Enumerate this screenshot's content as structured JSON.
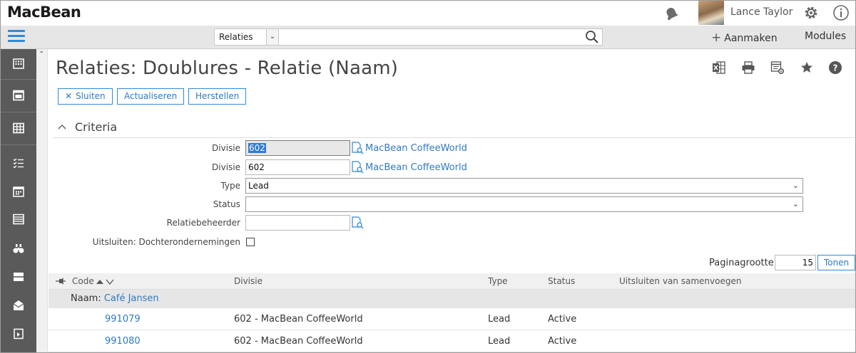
{
  "header": {
    "logo": "MacBean",
    "user_name": "Lance Taylor"
  },
  "navbar": {
    "search_scope": "Relaties",
    "search_value": "",
    "create_label": "Aanmaken",
    "modules_label": "Modules"
  },
  "sidebar": {
    "items": [
      "building-icon",
      "window-icon",
      "grid-icon",
      "checklist-icon",
      "calendar-icon",
      "list-icon",
      "binoculars-icon",
      "panel-icon",
      "mail-open-icon",
      "document-icon"
    ]
  },
  "page": {
    "title": "Relaties: Doublures - Relatie (Naam)",
    "toolbar_icons": [
      "excel-icon",
      "print-icon",
      "settings-table-icon",
      "star-icon",
      "help-icon"
    ],
    "buttons": {
      "close": "Sluiten",
      "refresh": "Actualiseren",
      "reset": "Herstellen"
    }
  },
  "criteria": {
    "heading": "Criteria",
    "fields": {
      "divisie1_label": "Divisie",
      "divisie1_value": "602",
      "divisie1_link": "MacBean CoffeeWorld",
      "divisie2_label": "Divisie",
      "divisie2_value": "602",
      "divisie2_link": "MacBean CoffeeWorld",
      "type_label": "Type",
      "type_value": "Lead",
      "status_label": "Status",
      "status_value": "",
      "manager_label": "Relatiebeheerder",
      "manager_value": "",
      "exclude_label": "Uitsluiten: Dochterondernemingen"
    }
  },
  "paging": {
    "label": "Paginagrootte",
    "value": "15",
    "show_label": "Tonen"
  },
  "table": {
    "columns": {
      "code": "Code",
      "divisie": "Divisie",
      "type": "Type",
      "status": "Status",
      "exclude": "Uitsluiten van samenvoegen"
    },
    "group": {
      "prefix": "Naam:",
      "name": "Café Jansen"
    },
    "rows": [
      {
        "code": "991079",
        "divisie": "602 - MacBean CoffeeWorld",
        "type": "Lead",
        "status": "Active"
      },
      {
        "code": "991080",
        "divisie": "602 - MacBean CoffeeWorld",
        "type": "Lead",
        "status": "Active"
      }
    ]
  },
  "colors": {
    "accent": "#2f8ad8",
    "link": "#2f7ac0",
    "sidebar": "#5a5a5a"
  }
}
